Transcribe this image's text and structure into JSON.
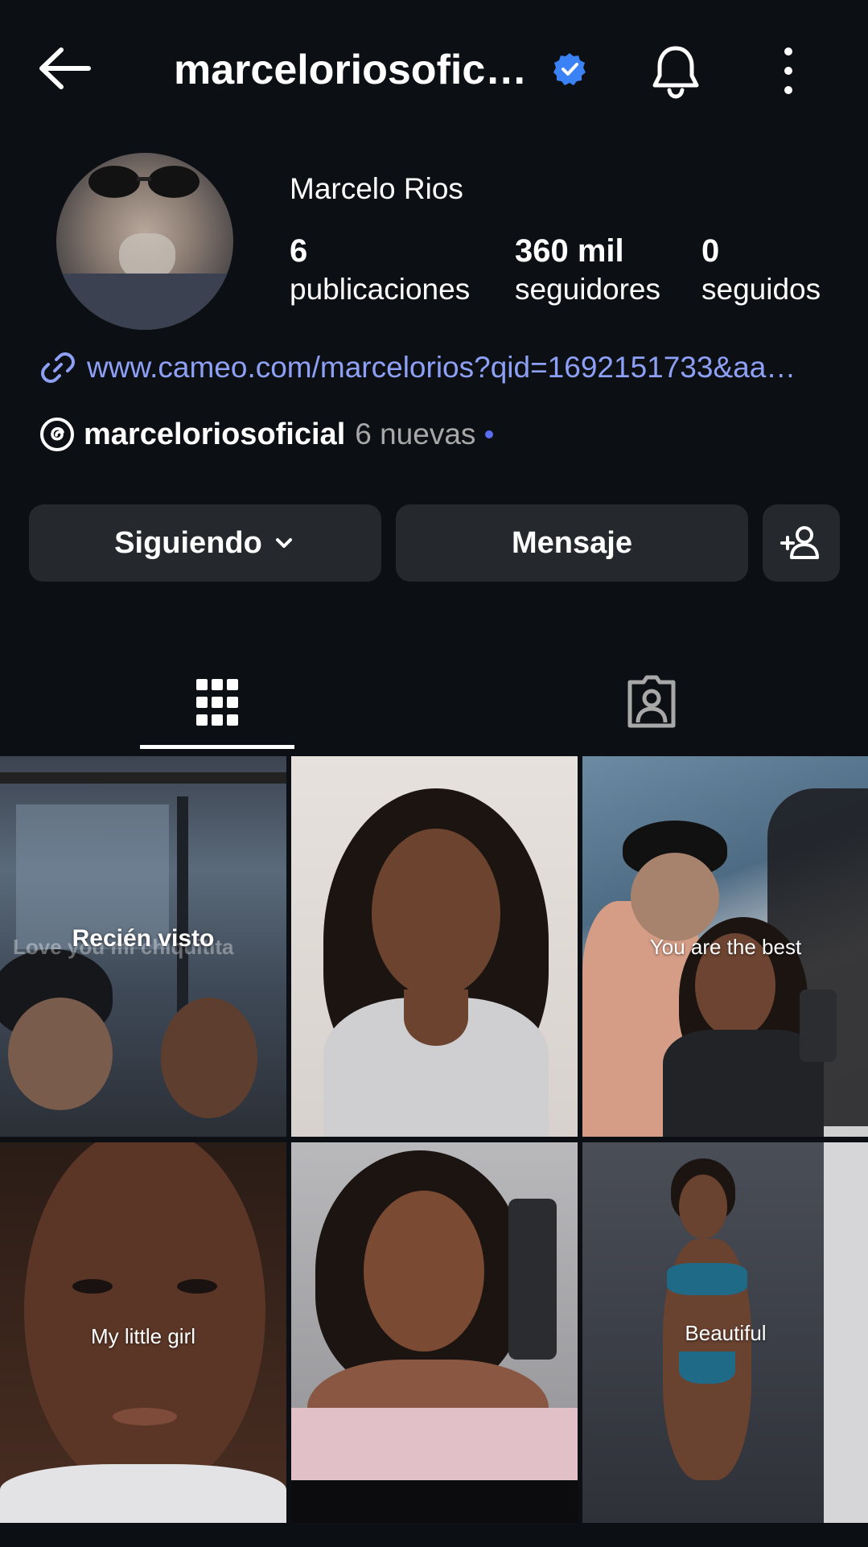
{
  "header": {
    "username": "marceloriosofic…",
    "back_icon": "arrow-left-icon",
    "verified_icon": "verified-badge-icon",
    "notifications_icon": "bell-icon",
    "more_icon": "more-vertical-icon"
  },
  "profile": {
    "display_name": "Marcelo Rios",
    "stats": {
      "posts": {
        "value": "6",
        "label": "publicaciones"
      },
      "followers": {
        "value": "360 mil",
        "label": "seguidores"
      },
      "following": {
        "value": "0",
        "label": "seguidos"
      }
    },
    "link": "www.cameo.com/marcelorios?qid=1692151733&aa…",
    "threads": {
      "handle": "marceloriosoficial",
      "new_label": "6 nuevas"
    }
  },
  "actions": {
    "following_label": "Siguiendo",
    "message_label": "Mensaje",
    "add_user_icon": "add-user-icon"
  },
  "tabs": [
    {
      "name": "posts-grid",
      "icon": "grid-icon",
      "active": true
    },
    {
      "name": "tagged",
      "icon": "tagged-user-icon",
      "active": false
    }
  ],
  "posts": [
    {
      "overlay": "Recién visto",
      "caption": "Love you mi chiquitita"
    },
    {
      "caption": ""
    },
    {
      "caption": "You are the best"
    },
    {
      "caption": "My little girl"
    },
    {
      "caption": ""
    },
    {
      "caption": "Beautiful"
    }
  ],
  "colors": {
    "background": "#0c1014",
    "button": "#25292e",
    "link": "#8ea0f5",
    "verified": "#3b82f6",
    "threads_dot": "#5b6cf0"
  }
}
